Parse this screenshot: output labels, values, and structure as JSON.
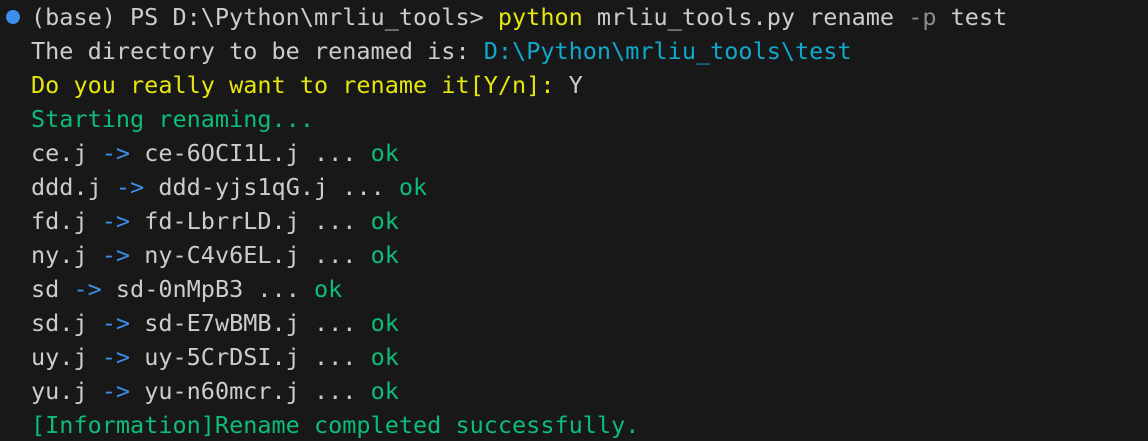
{
  "colors": {
    "background": "#181818",
    "default_text": "#cccccc",
    "yellow": "#e5e510",
    "cyan": "#11a8cd",
    "green": "#0dbc79",
    "blue": "#3b8eea",
    "prompt_dot": "#3b8eea"
  },
  "command": {
    "prompt": "(base) PS D:\\Python\\mrliu_tools> ",
    "exe": "python",
    "args_a": " mrliu_tools.py rename ",
    "flag": "-p",
    "args_b": " test"
  },
  "dir_line": {
    "label": "The directory to be renamed is: ",
    "path": "D:\\Python\\mrliu_tools\\test"
  },
  "confirm": {
    "question": "Do you really want to rename it[Y/n]:",
    "answer": " Y"
  },
  "starting": "Starting renaming...",
  "arrow": "->",
  "ellipsis": "...",
  "ok": "ok",
  "renames": [
    {
      "from": "ce.j",
      "to": "ce-6OCI1L.j"
    },
    {
      "from": "ddd.j",
      "to": "ddd-yjs1qG.j"
    },
    {
      "from": "fd.j",
      "to": "fd-LbrrLD.j"
    },
    {
      "from": "ny.j",
      "to": "ny-C4v6EL.j"
    },
    {
      "from": "sd",
      "to": "sd-0nMpB3"
    },
    {
      "from": "sd.j",
      "to": "sd-E7wBMB.j"
    },
    {
      "from": "uy.j",
      "to": "uy-5CrDSI.j"
    },
    {
      "from": "yu.j",
      "to": "yu-n60mcr.j"
    }
  ],
  "completed": "[Information]Rename completed successfully."
}
